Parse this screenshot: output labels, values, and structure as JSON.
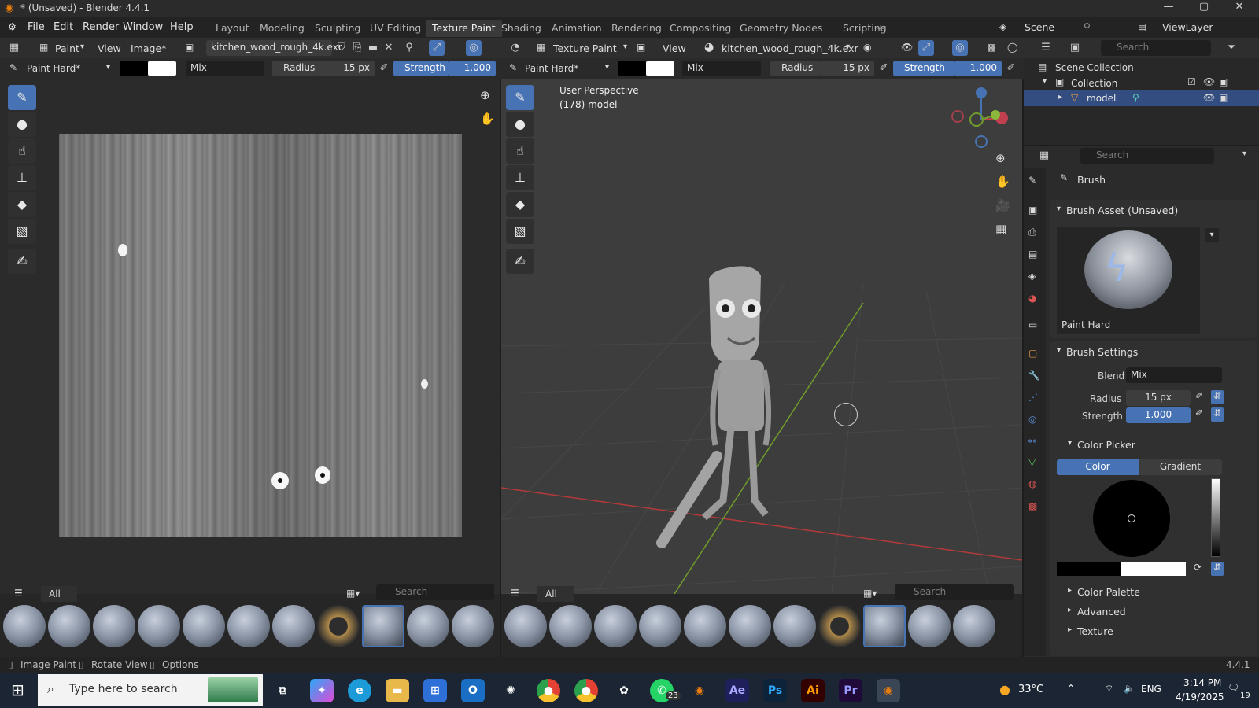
{
  "window": {
    "title": "* (Unsaved) - Blender 4.4.1",
    "controls": [
      "—",
      "▢",
      "✕"
    ]
  },
  "menu": [
    "File",
    "Edit",
    "Render",
    "Window",
    "Help"
  ],
  "workspaces": [
    "Layout",
    "Modeling",
    "Sculpting",
    "UV Editing",
    "Texture Paint",
    "Shading",
    "Animation",
    "Rendering",
    "Compositing",
    "Geometry Nodes",
    "Scripting",
    "+"
  ],
  "active_workspace": "Texture Paint",
  "scene": {
    "name": "Scene",
    "view_layer": "ViewLayer"
  },
  "image_editor": {
    "mode": "Paint",
    "view_label": "View",
    "image_menu": "Image*",
    "image_name": "kitchen_wood_rough_4k.exr",
    "brush": "Paint Hard*",
    "blend": "Mix",
    "radius_label": "Radius",
    "radius_value": "15 px",
    "strength_label": "Strength",
    "strength_value": "1.000"
  },
  "viewport": {
    "mode": "Texture Paint",
    "view_label": "View",
    "image_name": "kitchen_wood_rough_4k.exr",
    "brush": "Paint Hard*",
    "blend": "Mix",
    "radius_label": "Radius",
    "radius_value": "15 px",
    "strength_label": "Strength",
    "strength_value": "1.000",
    "overlay_line1": "User Perspective",
    "overlay_line2": "(178) model",
    "search_placeholder": "Search"
  },
  "outliner": {
    "search_placeholder": "Search",
    "scene_collection": "Scene Collection",
    "collection": "Collection",
    "object": "model"
  },
  "properties": {
    "search_placeholder": "Search",
    "header": "Brush",
    "asset_section": "Brush Asset (Unsaved)",
    "asset_name": "Paint Hard",
    "settings_section": "Brush Settings",
    "blend_label": "Blend",
    "blend_value": "Mix",
    "radius_label": "Radius",
    "radius_value": "15 px",
    "strength_label": "Strength",
    "strength_value": "1.000",
    "color_picker_section": "Color Picker",
    "color_tab": "Color",
    "gradient_tab": "Gradient",
    "color_palette": "Color Palette",
    "advanced": "Advanced",
    "texture": "Texture"
  },
  "shelf": {
    "filter_label": "All",
    "search_placeholder": "Search"
  },
  "statusbar": {
    "items": [
      "Image Paint",
      "Rotate View",
      "Options"
    ],
    "version": "4.4.1"
  },
  "taskbar": {
    "search_placeholder": "Type here to search",
    "weather": "33°C",
    "language": "ENG",
    "time": "3:14 PM",
    "date": "4/19/2025",
    "notification_count": "19",
    "whatsapp_badge": "23",
    "apps": [
      "Ae",
      "Ps",
      "Ai",
      "Pr"
    ]
  },
  "colors": {
    "accent_blue": "#4772b3",
    "axis_x_red": "#b33a3a",
    "axis_y_green": "#6f9c2a"
  }
}
